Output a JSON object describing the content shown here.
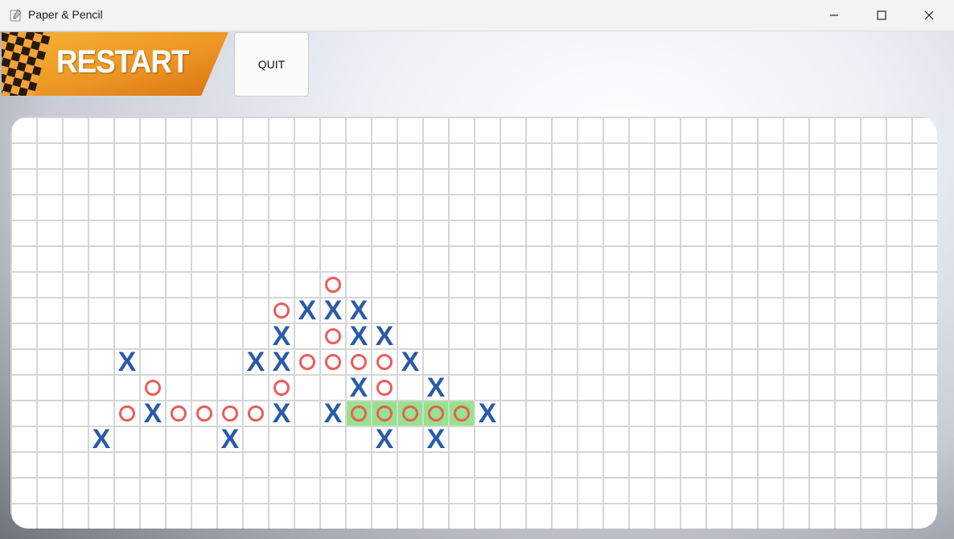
{
  "window": {
    "title": "Paper & Pencil",
    "icon": "paper-pencil-app-icon"
  },
  "toolbar": {
    "restart_label": "RESTART",
    "quit_label": "QUIT"
  },
  "colors": {
    "x": "#2a5ba8",
    "o": "#ec5c5c",
    "win_highlight": "#95e48d",
    "restart_orange": "#f2a127"
  },
  "board": {
    "columns": 36,
    "rows": 16,
    "marks": [
      {
        "row": 6,
        "col": 12,
        "mark": "O"
      },
      {
        "row": 7,
        "col": 10,
        "mark": "O"
      },
      {
        "row": 7,
        "col": 11,
        "mark": "X"
      },
      {
        "row": 7,
        "col": 12,
        "mark": "X"
      },
      {
        "row": 7,
        "col": 13,
        "mark": "X"
      },
      {
        "row": 8,
        "col": 10,
        "mark": "X"
      },
      {
        "row": 8,
        "col": 12,
        "mark": "O"
      },
      {
        "row": 8,
        "col": 13,
        "mark": "X"
      },
      {
        "row": 8,
        "col": 14,
        "mark": "X"
      },
      {
        "row": 9,
        "col": 4,
        "mark": "X"
      },
      {
        "row": 9,
        "col": 9,
        "mark": "X"
      },
      {
        "row": 9,
        "col": 10,
        "mark": "X"
      },
      {
        "row": 9,
        "col": 11,
        "mark": "O"
      },
      {
        "row": 9,
        "col": 12,
        "mark": "O"
      },
      {
        "row": 9,
        "col": 13,
        "mark": "O"
      },
      {
        "row": 9,
        "col": 14,
        "mark": "O"
      },
      {
        "row": 9,
        "col": 15,
        "mark": "X"
      },
      {
        "row": 10,
        "col": 5,
        "mark": "O"
      },
      {
        "row": 10,
        "col": 10,
        "mark": "O"
      },
      {
        "row": 10,
        "col": 13,
        "mark": "X"
      },
      {
        "row": 10,
        "col": 14,
        "mark": "O"
      },
      {
        "row": 10,
        "col": 16,
        "mark": "X"
      },
      {
        "row": 11,
        "col": 4,
        "mark": "O"
      },
      {
        "row": 11,
        "col": 5,
        "mark": "X"
      },
      {
        "row": 11,
        "col": 6,
        "mark": "O"
      },
      {
        "row": 11,
        "col": 7,
        "mark": "O"
      },
      {
        "row": 11,
        "col": 8,
        "mark": "O"
      },
      {
        "row": 11,
        "col": 9,
        "mark": "O"
      },
      {
        "row": 11,
        "col": 10,
        "mark": "X"
      },
      {
        "row": 11,
        "col": 12,
        "mark": "X"
      },
      {
        "row": 11,
        "col": 13,
        "mark": "O",
        "win": true
      },
      {
        "row": 11,
        "col": 14,
        "mark": "O",
        "win": true
      },
      {
        "row": 11,
        "col": 15,
        "mark": "O",
        "win": true
      },
      {
        "row": 11,
        "col": 16,
        "mark": "O",
        "win": true
      },
      {
        "row": 11,
        "col": 17,
        "mark": "O",
        "win": true
      },
      {
        "row": 11,
        "col": 18,
        "mark": "X"
      },
      {
        "row": 12,
        "col": 3,
        "mark": "X"
      },
      {
        "row": 12,
        "col": 8,
        "mark": "X"
      },
      {
        "row": 12,
        "col": 14,
        "mark": "X"
      },
      {
        "row": 12,
        "col": 16,
        "mark": "X"
      }
    ]
  }
}
